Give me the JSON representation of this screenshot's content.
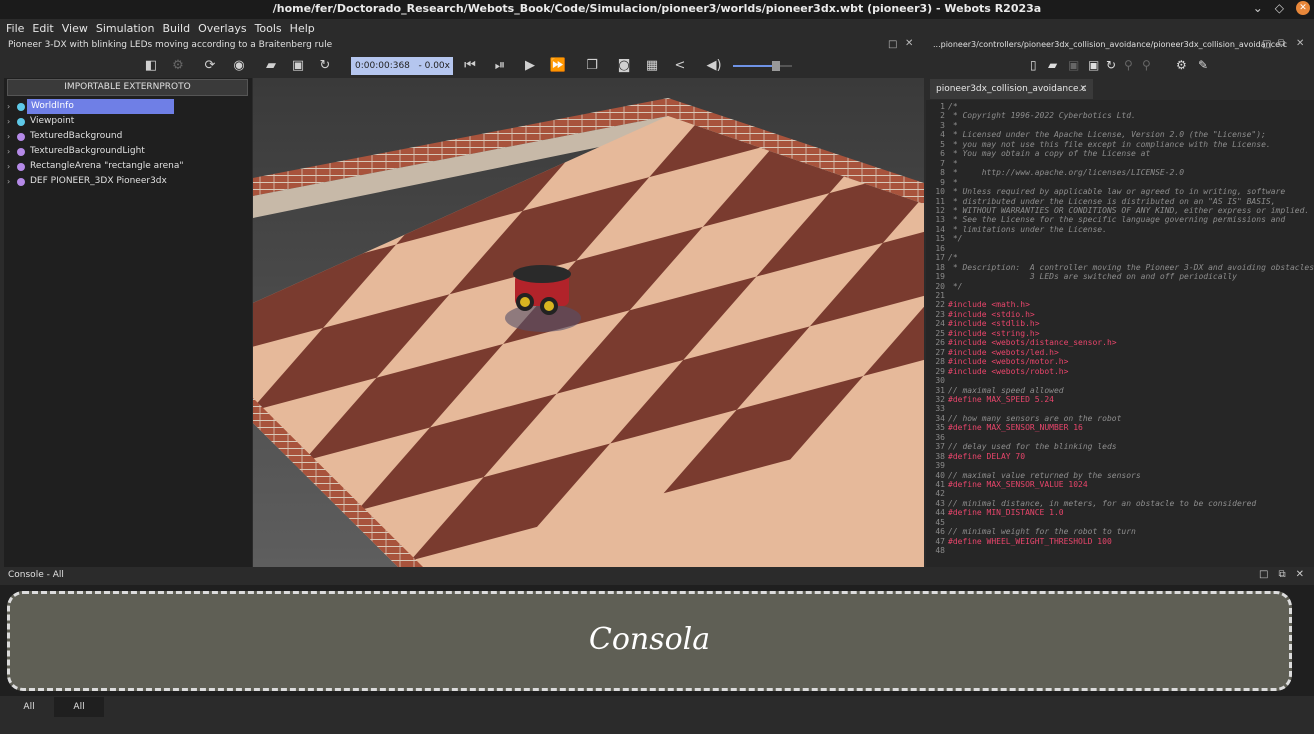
{
  "window": {
    "title": "/home/fer/Doctorado_Research/Webots_Book/Code/Simulacion/pioneer3/worlds/pioneer3dx.wbt (pioneer3) - Webots R2023a"
  },
  "menu": [
    "File",
    "Edit",
    "View",
    "Simulation",
    "Build",
    "Overlays",
    "Tools",
    "Help"
  ],
  "sim": {
    "description": "Pioneer 3-DX with blinking LEDs moving according to a Braitenberg rule",
    "time": "0:00:00:368",
    "speed": "- 0.00x"
  },
  "scene_tree": {
    "proto_button": "IMPORTABLE EXTERNPROTO",
    "items": [
      {
        "label": "WorldInfo",
        "color": "#5ec9e8",
        "selected": true
      },
      {
        "label": "Viewpoint",
        "color": "#5ec9e8",
        "selected": false
      },
      {
        "label": "TexturedBackground",
        "color": "#b58ae8",
        "selected": false
      },
      {
        "label": "TexturedBackgroundLight",
        "color": "#b58ae8",
        "selected": false
      },
      {
        "label": "RectangleArena \"rectangle arena\"",
        "color": "#b58ae8",
        "selected": false
      },
      {
        "label": "DEF PIONEER_3DX Pioneer3dx",
        "color": "#b58ae8",
        "selected": false
      }
    ]
  },
  "editor": {
    "path": "...pioneer3/controllers/pioneer3dx_collision_avoidance/pioneer3dx_collision_avoidance.c",
    "tab": "pioneer3dx_collision_avoidance.c",
    "lines": [
      {
        "n": "1",
        "t": "/*",
        "k": "com"
      },
      {
        "n": "2",
        "t": " * Copyright 1996-2022 Cyberbotics Ltd.",
        "k": "com"
      },
      {
        "n": "3",
        "t": " *",
        "k": "com"
      },
      {
        "n": "4",
        "t": " * Licensed under the Apache License, Version 2.0 (the \"License\");",
        "k": "com"
      },
      {
        "n": "5",
        "t": " * you may not use this file except in compliance with the License.",
        "k": "com"
      },
      {
        "n": "6",
        "t": " * You may obtain a copy of the License at",
        "k": "com"
      },
      {
        "n": "7",
        "t": " *",
        "k": "com"
      },
      {
        "n": "8",
        "t": " *     http://www.apache.org/licenses/LICENSE-2.0",
        "k": "com"
      },
      {
        "n": "9",
        "t": " *",
        "k": "com"
      },
      {
        "n": "10",
        "t": " * Unless required by applicable law or agreed to in writing, software",
        "k": "com"
      },
      {
        "n": "11",
        "t": " * distributed under the License is distributed on an \"AS IS\" BASIS,",
        "k": "com"
      },
      {
        "n": "12",
        "t": " * WITHOUT WARRANTIES OR CONDITIONS OF ANY KIND, either express or implied.",
        "k": "com"
      },
      {
        "n": "13",
        "t": " * See the License for the specific language governing permissions and",
        "k": "com"
      },
      {
        "n": "14",
        "t": " * limitations under the License.",
        "k": "com"
      },
      {
        "n": "15",
        "t": " */",
        "k": "com"
      },
      {
        "n": "16",
        "t": "",
        "k": "com"
      },
      {
        "n": "17",
        "t": "/*",
        "k": "com"
      },
      {
        "n": "18",
        "t": " * Description:  A controller moving the Pioneer 3-DX and avoiding obstacles.",
        "k": "com"
      },
      {
        "n": "19",
        "t": "                 3 LEDs are switched on and off periodically",
        "k": "com"
      },
      {
        "n": "20",
        "t": " */",
        "k": "com"
      },
      {
        "n": "21",
        "t": "",
        "k": "com"
      },
      {
        "n": "22",
        "t": "#include <math.h>",
        "k": "pre"
      },
      {
        "n": "23",
        "t": "#include <stdio.h>",
        "k": "pre"
      },
      {
        "n": "24",
        "t": "#include <stdlib.h>",
        "k": "pre"
      },
      {
        "n": "25",
        "t": "#include <string.h>",
        "k": "pre"
      },
      {
        "n": "26",
        "t": "#include <webots/distance_sensor.h>",
        "k": "pre"
      },
      {
        "n": "27",
        "t": "#include <webots/led.h>",
        "k": "pre"
      },
      {
        "n": "28",
        "t": "#include <webots/motor.h>",
        "k": "pre"
      },
      {
        "n": "29",
        "t": "#include <webots/robot.h>",
        "k": "pre"
      },
      {
        "n": "30",
        "t": "",
        "k": "com"
      },
      {
        "n": "31",
        "t": "// maximal speed allowed",
        "k": "com"
      },
      {
        "n": "32",
        "t": "#define MAX_SPEED 5.24",
        "k": "pre"
      },
      {
        "n": "33",
        "t": "",
        "k": "com"
      },
      {
        "n": "34",
        "t": "// how many sensors are on the robot",
        "k": "com"
      },
      {
        "n": "35",
        "t": "#define MAX_SENSOR_NUMBER 16",
        "k": "pre"
      },
      {
        "n": "36",
        "t": "",
        "k": "com"
      },
      {
        "n": "37",
        "t": "// delay used for the blinking leds",
        "k": "com"
      },
      {
        "n": "38",
        "t": "#define DELAY 70",
        "k": "pre"
      },
      {
        "n": "39",
        "t": "",
        "k": "com"
      },
      {
        "n": "40",
        "t": "// maximal value returned by the sensors",
        "k": "com"
      },
      {
        "n": "41",
        "t": "#define MAX_SENSOR_VALUE 1024",
        "k": "pre"
      },
      {
        "n": "42",
        "t": "",
        "k": "com"
      },
      {
        "n": "43",
        "t": "// minimal distance, in meters, for an obstacle to be considered",
        "k": "com"
      },
      {
        "n": "44",
        "t": "#define MIN_DISTANCE 1.0",
        "k": "pre"
      },
      {
        "n": "45",
        "t": "",
        "k": "com"
      },
      {
        "n": "46",
        "t": "// minimal weight for the robot to turn",
        "k": "com"
      },
      {
        "n": "47",
        "t": "#define WHEEL_WEIGHT_THRESHOLD 100",
        "k": "pre"
      },
      {
        "n": "48",
        "t": "",
        "k": "com"
      }
    ]
  },
  "console": {
    "title": "Console - All",
    "overlay_label": "Consola",
    "tabs": [
      "All",
      "All"
    ]
  },
  "colors": {
    "selection": "#6f7fe6",
    "time_box": "#b5c6ef",
    "code_keyword": "#e8456b",
    "console_overlay": "#5f5f55"
  }
}
